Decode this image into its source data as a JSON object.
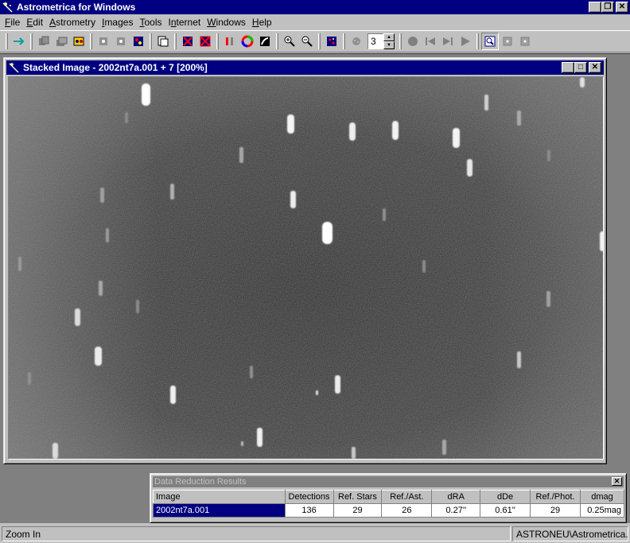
{
  "app": {
    "title": "Astrometrica for Windows"
  },
  "menu": [
    {
      "label": "File",
      "key": "F"
    },
    {
      "label": "Edit",
      "key": "E"
    },
    {
      "label": "Astrometry",
      "key": "A"
    },
    {
      "label": "Images",
      "key": "I"
    },
    {
      "label": "Tools",
      "key": "T"
    },
    {
      "label": "Internet",
      "key": "n"
    },
    {
      "label": "Windows",
      "key": "W"
    },
    {
      "label": "Help",
      "key": "H"
    }
  ],
  "toolbar": {
    "stack_count": "3"
  },
  "image_window": {
    "title": "Stacked Image - 2002nt7a.001 + 7 [200%]"
  },
  "results": {
    "title": "Data Reduction Results",
    "columns": [
      "Image",
      "Detections",
      "Ref. Stars",
      "Ref./Ast.",
      "dRA",
      "dDe",
      "Ref./Phot.",
      "dmag"
    ],
    "row": [
      "2002nt7a.001",
      "136",
      "29",
      "26",
      "0.27''",
      "0.61''",
      "29",
      "0.25mag"
    ]
  },
  "status": {
    "hint": "Zoom In",
    "config": "ASTRONEU\\Astrometrica.cfg"
  },
  "colors": {
    "titlebar_active": "#000080",
    "titlebar_inactive": "#808080",
    "face": "#c0c0c0",
    "mdi_background": "#808080"
  }
}
